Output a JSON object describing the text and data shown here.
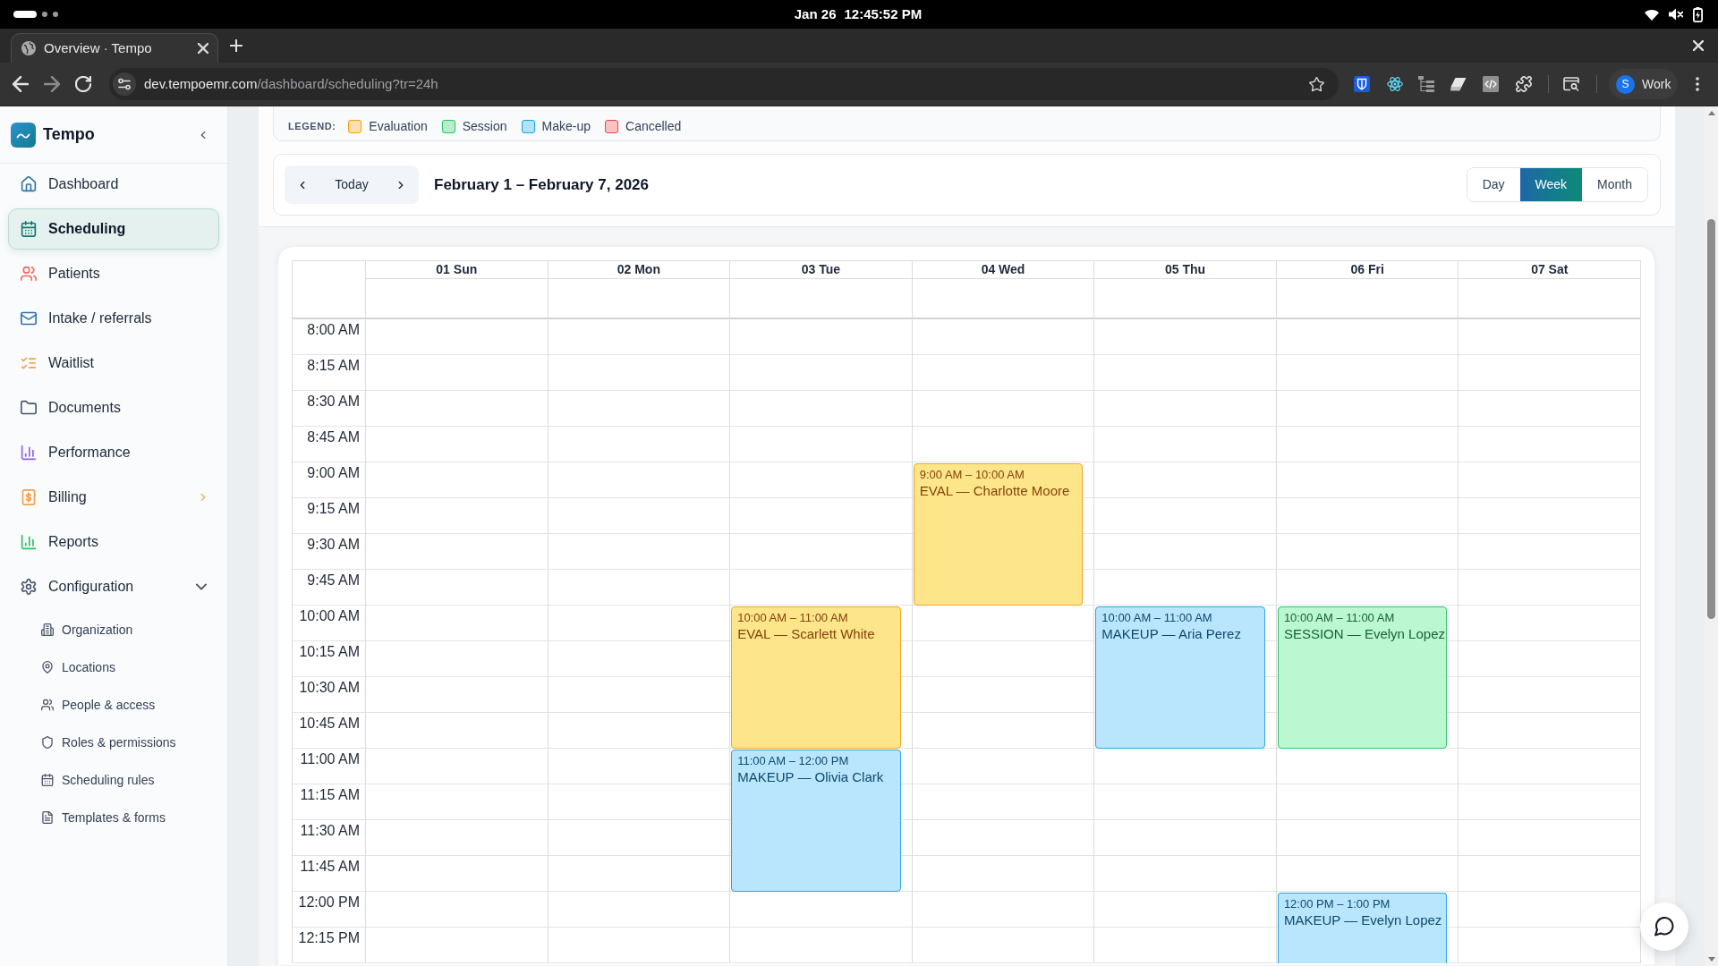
{
  "system_bar": {
    "date": "Jan 26",
    "time": "12:45:52 PM"
  },
  "browser": {
    "tabs": [
      {
        "title": "Overview · Tempo",
        "selected": true
      }
    ],
    "address": {
      "host": "dev.tempoemr.com",
      "path": "/dashboard/scheduling?tr=24h"
    },
    "profile": {
      "initial": "S",
      "label": "Work"
    }
  },
  "sidebar": {
    "brand": "Tempo",
    "items": [
      {
        "label": "Dashboard",
        "selected": false
      },
      {
        "label": "Scheduling",
        "selected": true
      },
      {
        "label": "Patients",
        "selected": false
      },
      {
        "label": "Intake / referrals",
        "selected": false
      },
      {
        "label": "Waitlist",
        "selected": false
      },
      {
        "label": "Documents",
        "selected": false
      },
      {
        "label": "Performance",
        "selected": false
      },
      {
        "label": "Billing",
        "selected": false,
        "expanded": false
      },
      {
        "label": "Reports",
        "selected": false
      },
      {
        "label": "Configuration",
        "selected": false,
        "expanded": true,
        "children": [
          {
            "label": "Organization",
            "selected": false
          },
          {
            "label": "Locations",
            "selected": false
          },
          {
            "label": "People & access",
            "selected": false
          },
          {
            "label": "Roles & permissions",
            "selected": false
          },
          {
            "label": "Scheduling rules",
            "selected": false
          },
          {
            "label": "Templates & forms",
            "selected": false
          }
        ]
      }
    ]
  },
  "legend": {
    "label": "LEGEND:",
    "items": [
      {
        "label": "Evaluation",
        "color": "#f59e0b"
      },
      {
        "label": "Session",
        "color": "#22c55e"
      },
      {
        "label": "Make-up",
        "color": "#0ea5e9"
      },
      {
        "label": "Cancelled",
        "color": "#ef4444"
      }
    ]
  },
  "toolbar": {
    "today": "Today",
    "range": "February 1 – February 7, 2026",
    "views": [
      {
        "label": "Day",
        "selected": false
      },
      {
        "label": "Week",
        "selected": true
      },
      {
        "label": "Month",
        "selected": false
      }
    ]
  },
  "calendar": {
    "days": [
      {
        "label": "01 Sun"
      },
      {
        "label": "02 Mon"
      },
      {
        "label": "03 Tue",
        "events": [
          {
            "kind": "evaluation",
            "time": "10:00 AM – 11:00 AM",
            "title": "EVAL — Scarlett White"
          },
          {
            "kind": "makeup",
            "time": "11:00 AM – 12:00 PM",
            "title": "MAKEUP — Olivia Clark"
          }
        ]
      },
      {
        "label": "04 Wed",
        "events": [
          {
            "kind": "evaluation",
            "time": "9:00 AM – 10:00 AM",
            "title": "EVAL — Charlotte Moore"
          }
        ]
      },
      {
        "label": "05 Thu",
        "events": [
          {
            "kind": "makeup",
            "time": "10:00 AM – 11:00 AM",
            "title": "MAKEUP — Aria Perez"
          }
        ]
      },
      {
        "label": "06 Fri",
        "events": [
          {
            "kind": "session",
            "time": "10:00 AM – 11:00 AM",
            "title": "SESSION — Evelyn Lopez"
          },
          {
            "kind": "makeup",
            "time": "12:00 PM – 1:00 PM",
            "title": "MAKEUP — Evelyn Lopez"
          }
        ]
      },
      {
        "label": "07 Sat"
      }
    ],
    "times": [
      "8:00 AM",
      "8:15 AM",
      "8:30 AM",
      "8:45 AM",
      "9:00 AM",
      "9:15 AM",
      "9:30 AM",
      "9:45 AM",
      "10:00 AM",
      "10:15 AM",
      "10:30 AM",
      "10:45 AM",
      "11:00 AM",
      "11:15 AM",
      "11:30 AM",
      "11:45 AM",
      "12:00 PM",
      "12:15 PM"
    ]
  }
}
